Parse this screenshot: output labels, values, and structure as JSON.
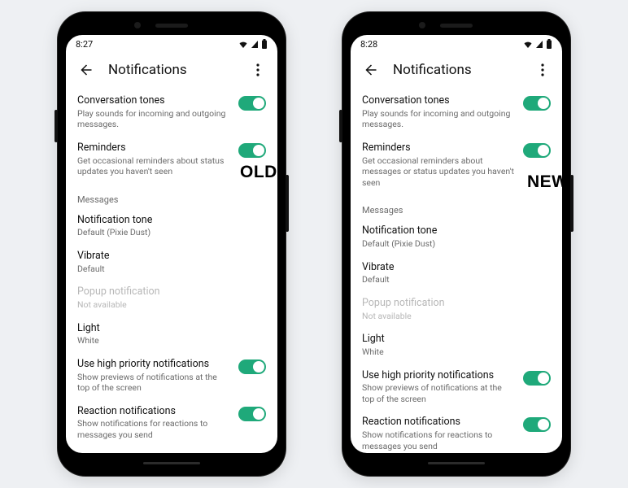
{
  "badges": {
    "left": "OLD",
    "right": "NEW"
  },
  "phones": {
    "left": {
      "time": "8:27",
      "title": "Notifications",
      "rows": {
        "conv_tones": {
          "label": "Conversation tones",
          "sub": "Play sounds for incoming and outgoing messages."
        },
        "reminders": {
          "label": "Reminders",
          "sub": "Get occasional reminders about status updates you haven't seen"
        },
        "section_messages": "Messages",
        "notif_tone": {
          "label": "Notification tone",
          "sub": "Default (Pixie Dust)"
        },
        "vibrate": {
          "label": "Vibrate",
          "sub": "Default"
        },
        "popup": {
          "label": "Popup notification",
          "sub": "Not available"
        },
        "light": {
          "label": "Light",
          "sub": "White"
        },
        "high_prio": {
          "label": "Use high priority notifications",
          "sub": "Show previews of notifications at the top of the screen"
        },
        "reaction": {
          "label": "Reaction notifications",
          "sub": "Show notifications for reactions to messages you send"
        }
      }
    },
    "right": {
      "time": "8:28",
      "title": "Notifications",
      "rows": {
        "conv_tones": {
          "label": "Conversation tones",
          "sub": "Play sounds for incoming and outgoing messages."
        },
        "reminders": {
          "label": "Reminders",
          "sub": "Get occasional reminders about messages or status updates you haven't seen"
        },
        "section_messages": "Messages",
        "notif_tone": {
          "label": "Notification tone",
          "sub": "Default (Pixie Dust)"
        },
        "vibrate": {
          "label": "Vibrate",
          "sub": "Default"
        },
        "popup": {
          "label": "Popup notification",
          "sub": "Not available"
        },
        "light": {
          "label": "Light",
          "sub": "White"
        },
        "high_prio": {
          "label": "Use high priority notifications",
          "sub": "Show previews of notifications at the top of the screen"
        },
        "reaction": {
          "label": "Reaction notifications",
          "sub": "Show notifications for reactions to messages you send"
        }
      }
    }
  }
}
